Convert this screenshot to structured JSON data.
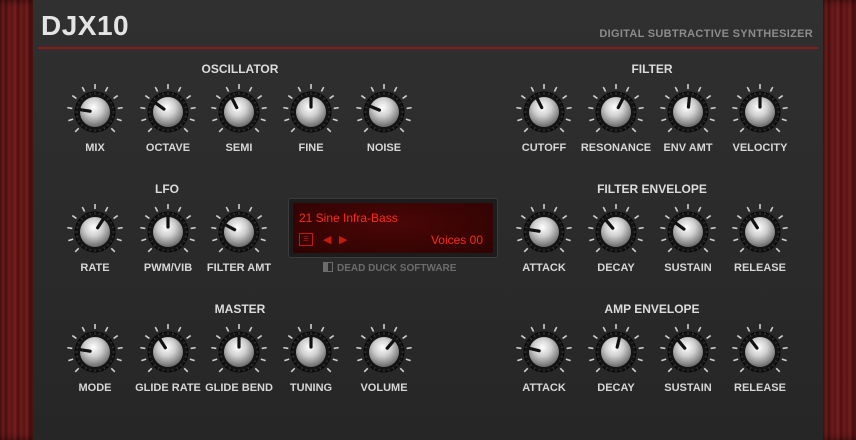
{
  "header": {
    "title": "DJX10",
    "subtitle": "DIGITAL SUBTRACTIVE SYNTHESIZER"
  },
  "colors": {
    "accent_red": "#8a1c1c",
    "lcd_text": "#ff2a1a",
    "panel": "#2a2a2a",
    "wood": "#6e1c1c"
  },
  "sections": {
    "oscillator": "OSCILLATOR",
    "filter": "FILTER",
    "lfo": "LFO",
    "filter_envelope": "FILTER ENVELOPE",
    "master": "MASTER",
    "amp_envelope": "AMP ENVELOPE"
  },
  "knobs": {
    "mix": {
      "label": "MIX",
      "value": 0.2
    },
    "octave": {
      "label": "OCTAVE",
      "value": 0.3
    },
    "semi": {
      "label": "SEMI",
      "value": 0.4
    },
    "fine": {
      "label": "FINE",
      "value": 0.5
    },
    "noise": {
      "label": "NOISE",
      "value": 0.25
    },
    "cutoff": {
      "label": "CUTOFF",
      "value": 0.4
    },
    "resonance": {
      "label": "RESONANCE",
      "value": 0.6
    },
    "env_amt": {
      "label": "ENV AMT",
      "value": 0.52
    },
    "velocity": {
      "label": "VELOCITY",
      "value": 0.5
    },
    "rate": {
      "label": "RATE",
      "value": 0.62
    },
    "pwm_vib": {
      "label": "PWM/VIB",
      "value": 0.5
    },
    "filter_amt": {
      "label": "FILTER AMT",
      "value": 0.27
    },
    "f_attack": {
      "label": "ATTACK",
      "value": 0.2
    },
    "f_decay": {
      "label": "DECAY",
      "value": 0.35
    },
    "f_sustain": {
      "label": "SUSTAIN",
      "value": 0.3
    },
    "f_release": {
      "label": "RELEASE",
      "value": 0.38
    },
    "mode": {
      "label": "MODE",
      "value": 0.2
    },
    "glide_rate": {
      "label": "GLIDE RATE",
      "value": 0.38
    },
    "glide_bend": {
      "label": "GLIDE BEND",
      "value": 0.5
    },
    "tuning": {
      "label": "TUNING",
      "value": 0.5
    },
    "volume": {
      "label": "VOLUME",
      "value": 0.65
    },
    "a_attack": {
      "label": "ATTACK",
      "value": 0.22
    },
    "a_decay": {
      "label": "DECAY",
      "value": 0.55
    },
    "a_sustain": {
      "label": "SUSTAIN",
      "value": 0.35
    },
    "a_release": {
      "label": "RELEASE",
      "value": 0.36
    }
  },
  "display": {
    "patch": "21  Sine Infra-Bass",
    "voices": "Voices 00",
    "menu_icon": "menu-icon",
    "prev_icon": "triangle-left-icon",
    "next_icon": "triangle-right-icon"
  },
  "footer": {
    "credit": "DEAD DUCK SOFTWARE"
  }
}
